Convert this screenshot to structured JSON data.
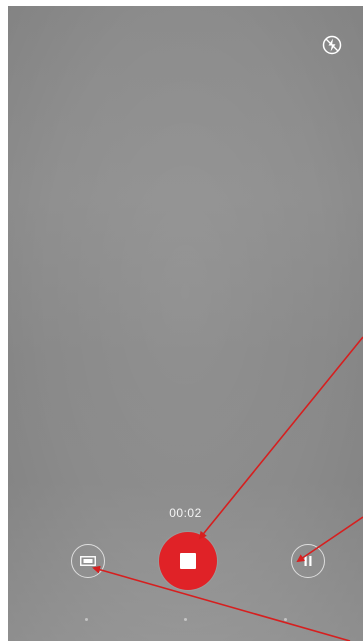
{
  "recorder": {
    "timer": "00:02"
  },
  "icons": {
    "flash": "flash-auto-icon",
    "stop": "stop-icon",
    "pause": "pause-icon",
    "snapshot": "camera-snapshot-icon"
  },
  "colors": {
    "record_red": "#e02227",
    "annotation_arrow": "#d61f1f",
    "viewfinder_gray": "#8c8c8c"
  },
  "pager": {
    "page_count": 3
  }
}
